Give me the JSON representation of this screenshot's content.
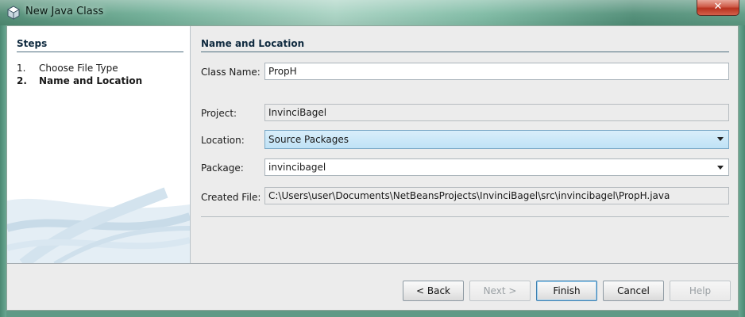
{
  "window": {
    "title": "New Java Class",
    "close_label": "✕"
  },
  "steps": {
    "title": "Steps",
    "items": [
      {
        "number": "1.",
        "label": "Choose File Type",
        "current": false
      },
      {
        "number": "2.",
        "label": "Name and Location",
        "current": true
      }
    ]
  },
  "panel": {
    "title": "Name and Location",
    "class_name": {
      "label": "Class Name:",
      "value": "PropH"
    },
    "project": {
      "label": "Project:",
      "value": "InvinciBagel"
    },
    "location": {
      "label": "Location:",
      "value": "Source Packages"
    },
    "package": {
      "label": "Package:",
      "value": "invincibagel"
    },
    "created_file": {
      "label": "Created File:",
      "value": "C:\\Users\\user\\Documents\\NetBeansProjects\\InvinciBagel\\src\\invincibagel\\PropH.java"
    }
  },
  "buttons": {
    "back": "< Back",
    "next": "Next >",
    "finish": "Finish",
    "cancel": "Cancel",
    "help": "Help"
  },
  "icons": {
    "app": "java-class-cube-icon",
    "close": "close-icon",
    "dropdown": "chevron-down-icon"
  },
  "colors": {
    "titlebar": "#6fae96",
    "close_button": "#cf5b48",
    "panel_background": "#ececec",
    "location_highlight": "#bfe2f6",
    "heading_text": "#0f2a3f"
  }
}
